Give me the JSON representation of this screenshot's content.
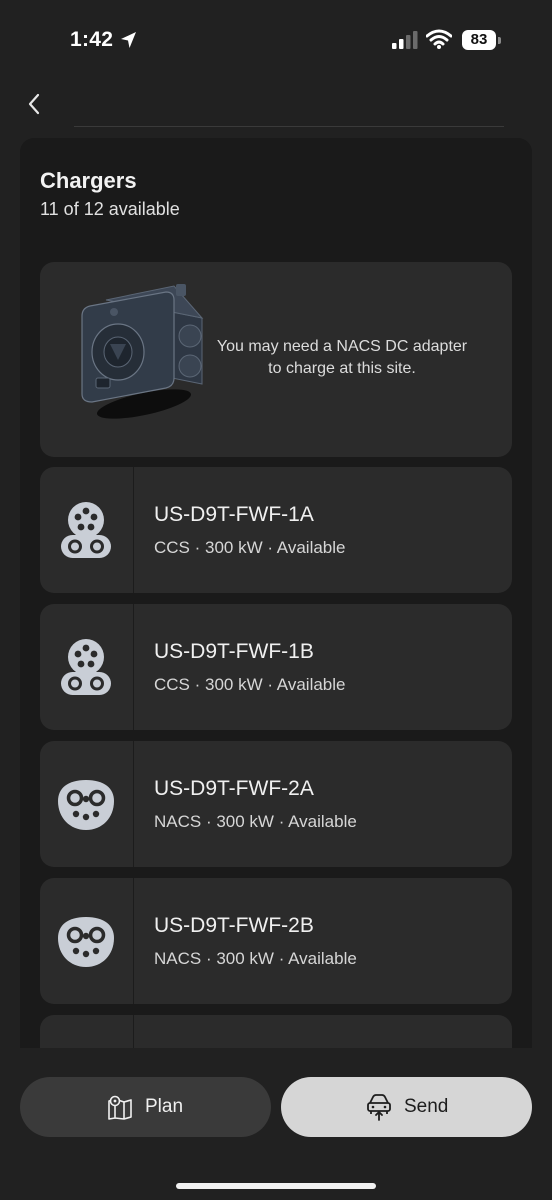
{
  "status_bar": {
    "time": "1:42",
    "battery": "83"
  },
  "panel": {
    "title": "Chargers",
    "subtitle": "11 of 12 available"
  },
  "adapter_notice": {
    "text": "You may need a NACS DC adapter to charge at this site."
  },
  "chargers": [
    {
      "name": "US-D9T-FWF-1A",
      "details": "CCS · 300 kW · Available",
      "connector": "ccs-connector-icon"
    },
    {
      "name": "US-D9T-FWF-1B",
      "details": "CCS · 300 kW · Available",
      "connector": "ccs-connector-icon"
    },
    {
      "name": "US-D9T-FWF-2A",
      "details": "NACS · 300 kW · Available",
      "connector": "nacs-connector-icon"
    },
    {
      "name": "US-D9T-FWF-2B",
      "details": "NACS · 300 kW · Available",
      "connector": "nacs-connector-icon"
    }
  ],
  "actions": {
    "plan_label": "Plan",
    "send_label": "Send"
  },
  "colors": {
    "background": "#212121",
    "panel": "#1a1a1a",
    "card": "#2b2b2b",
    "icon": "#c9ced6"
  }
}
